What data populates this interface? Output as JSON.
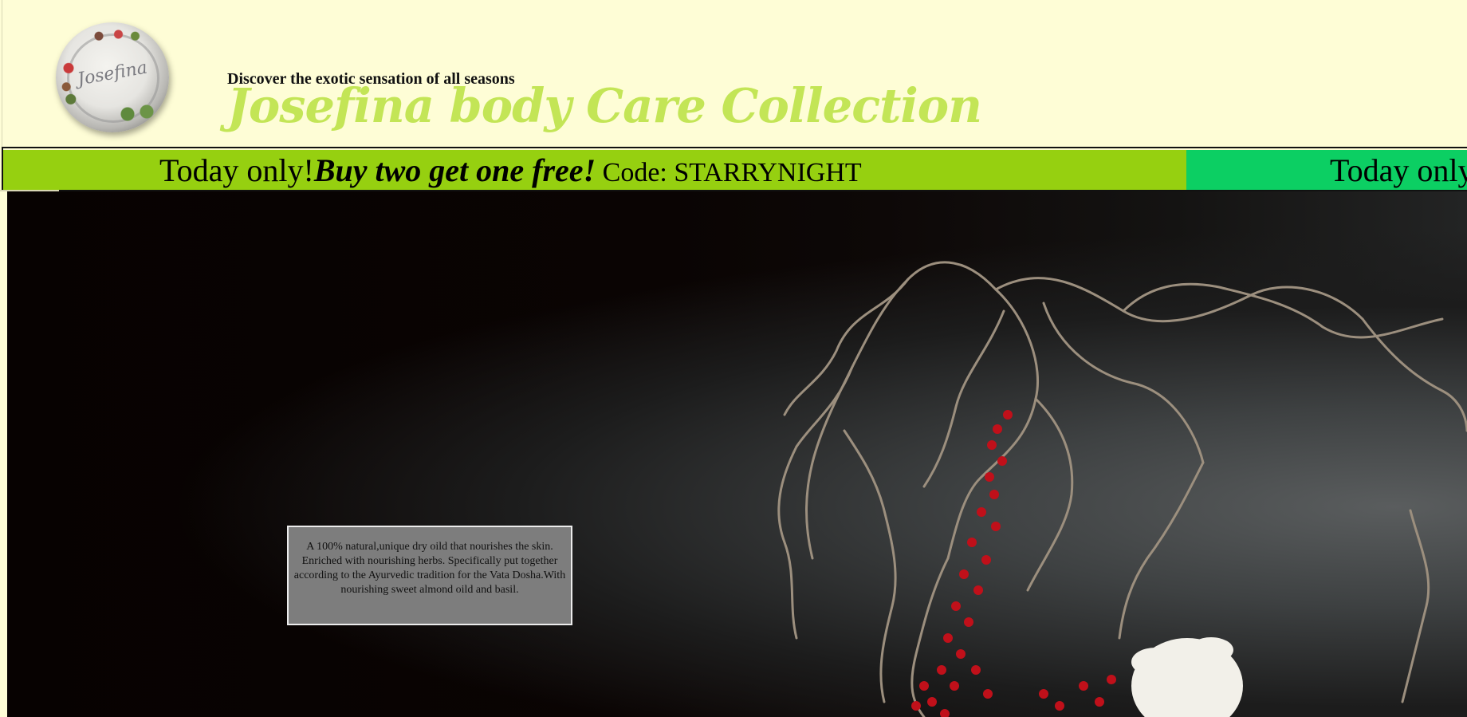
{
  "header": {
    "logo_text": "Josefina",
    "tagline": "Discover the exotic sensation of all seasons",
    "title": "Josefina body Care Collection"
  },
  "promo_banner": {
    "items": [
      {
        "lead": "Today only!",
        "offer": "Buy two get one free!",
        "code": " Code: STARRYNIGHT"
      },
      {
        "lead": "Today only",
        "offer": "",
        "code": ""
      }
    ],
    "colors": {
      "primary": "#96d010",
      "secondary": "#0ccf63"
    }
  },
  "hero": {
    "description": "A 100% natural,unique dry oild that nourishes the skin. Enriched with nourishing herbs. Specifically put together according to the Ayurvedic tradition for the Vata Dosha.With nourishing sweet almond oild and basil."
  },
  "colors": {
    "page_background": "#fefdd6",
    "title_green": "#c3e556",
    "description_box": "#7d7d7d"
  }
}
